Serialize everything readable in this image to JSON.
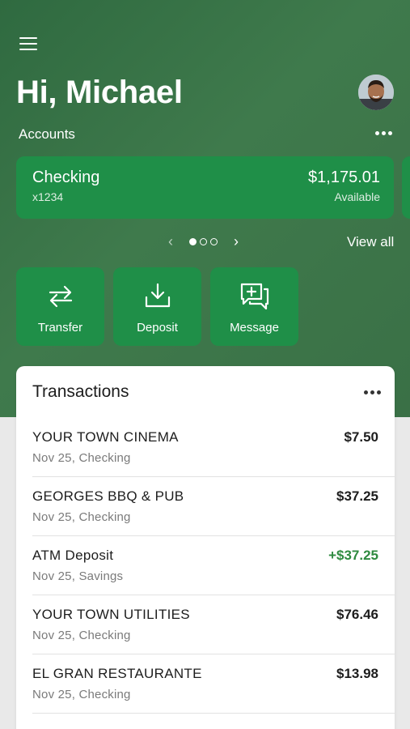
{
  "header": {
    "greeting": "Hi, Michael",
    "accounts_label": "Accounts"
  },
  "icons": {
    "menu": "hamburger-menu-icon",
    "avatar": "user-avatar",
    "more": "more-horizontal-icon",
    "transfer": "transfer-arrows-icon",
    "deposit": "download-tray-icon",
    "message": "chat-plus-icon"
  },
  "account": {
    "name": "Checking",
    "number": "x1234",
    "balance": "$1,175.01",
    "balance_label": "Available"
  },
  "pager": {
    "pages": 3,
    "current": 1
  },
  "view_all": "View all",
  "actions": [
    {
      "label": "Transfer"
    },
    {
      "label": "Deposit"
    },
    {
      "label": "Message"
    }
  ],
  "transactions": {
    "title": "Transactions",
    "items": [
      {
        "name": "YOUR TOWN CINEMA",
        "sub": "Nov 25, Checking",
        "amount": "$7.50",
        "type": "debit"
      },
      {
        "name": "GEORGES BBQ & PUB",
        "sub": "Nov 25, Checking",
        "amount": "$37.25",
        "type": "debit"
      },
      {
        "name": "ATM Deposit",
        "sub": "Nov 25, Savings",
        "amount": "+$37.25",
        "type": "credit"
      },
      {
        "name": "YOUR TOWN UTILITIES",
        "sub": "Nov 25, Checking",
        "amount": "$76.46",
        "type": "debit"
      },
      {
        "name": "EL GRAN RESTAURANTE",
        "sub": "Nov 25, Checking",
        "amount": "$13.98",
        "type": "debit"
      }
    ]
  },
  "colors": {
    "brand_green": "#1f8f48",
    "hero_bg": "#3a7046",
    "credit_green": "#2e8a3f"
  }
}
